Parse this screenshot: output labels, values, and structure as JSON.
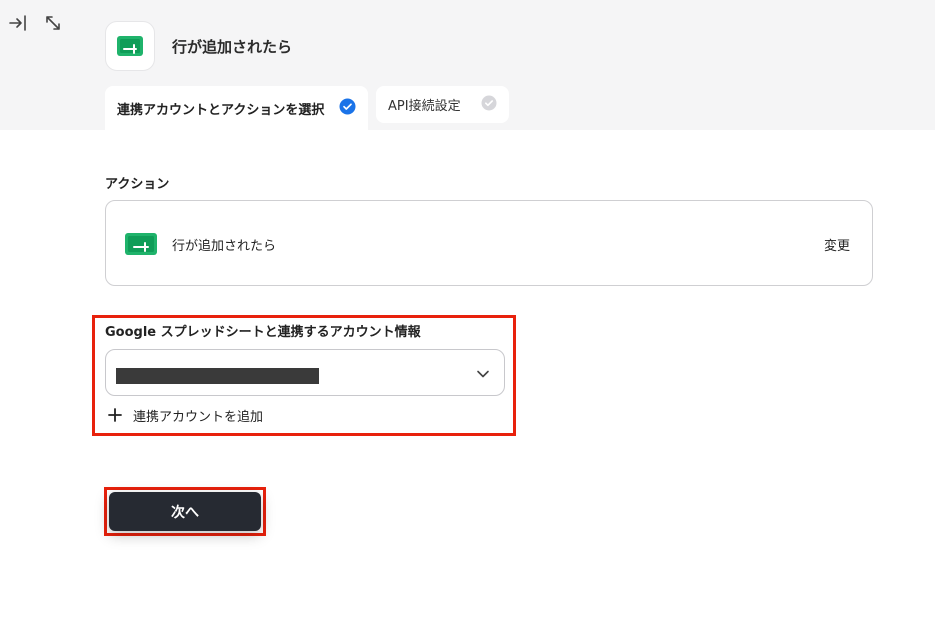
{
  "header": {
    "app_title": "行が追加されたら",
    "icons": [
      "collapse-panel-icon",
      "resize-diagonal-icon"
    ],
    "app_icon": "spreadsheet-icon"
  },
  "tabs": [
    {
      "label": "連携アカウントとアクションを選択",
      "state": "active",
      "status_color": "#1a73e8"
    },
    {
      "label": "API接続設定",
      "state": "inactive",
      "status_color": "#d0d0d4"
    }
  ],
  "action": {
    "section_label": "アクション",
    "selected": "行が追加されたら",
    "change_label": "変更"
  },
  "account": {
    "section_label": "Google スプレッドシートと連携するアカウント情報",
    "selected_value": "████████████████",
    "add_label": "連携アカウントを追加"
  },
  "next_button": {
    "label": "次へ"
  },
  "colors": {
    "highlight": "#e8210c",
    "button_bg": "#262a32",
    "header_bg": "#f5f5f6",
    "sheet_green": "#1fb36b"
  }
}
